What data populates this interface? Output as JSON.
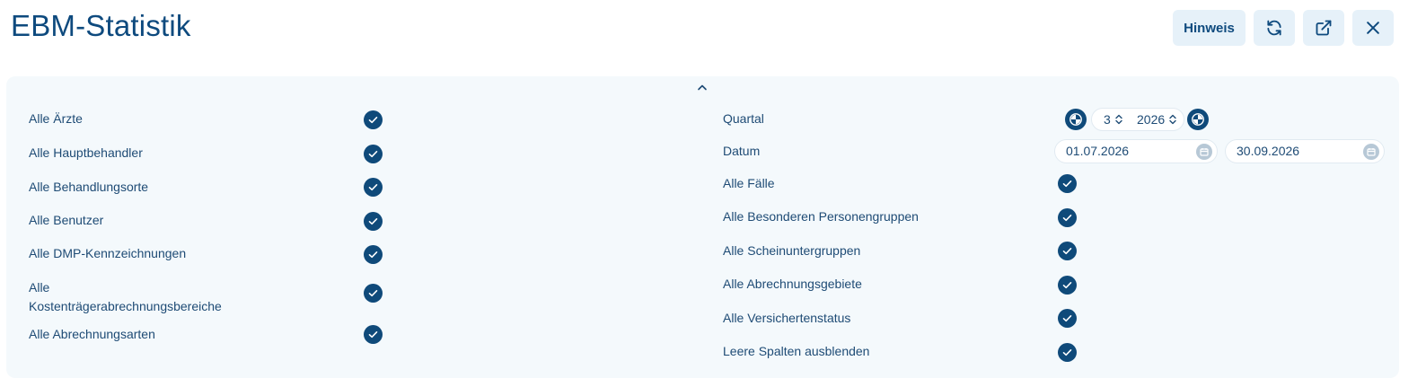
{
  "header": {
    "title": "EBM-Statistik",
    "hint_label": "Hinweis"
  },
  "icons": {
    "refresh": "refresh-icon",
    "external": "external-link-icon",
    "close": "close-icon",
    "collapse": "chevron-up-icon",
    "check": "check-icon",
    "quarter_prev": "quarter-prev-icon",
    "quarter_next": "quarter-next-icon",
    "calendar": "calendar-icon"
  },
  "colors": {
    "accent": "#0f4a7a",
    "button_bg": "#e6f1f9",
    "panel_bg": "#f4f9fc"
  },
  "left_filters": [
    {
      "label": "Alle Ärzte",
      "checked": true
    },
    {
      "label": "Alle Hauptbehandler",
      "checked": true
    },
    {
      "label": "Alle Behandlungsorte",
      "checked": true
    },
    {
      "label": "Alle Benutzer",
      "checked": true
    },
    {
      "label": "Alle DMP-Kennzeichnungen",
      "checked": true
    },
    {
      "label": "Alle",
      "label_line2": "Kostenträgerabrechnungsbereiche",
      "checked": true
    },
    {
      "label": "Alle Abrechnungsarten",
      "checked": true
    }
  ],
  "quarter": {
    "label": "Quartal",
    "quarter_value": "3",
    "year_value": "2026"
  },
  "date": {
    "label": "Datum",
    "from": "01.07.2026",
    "to": "30.09.2026"
  },
  "right_filters": [
    {
      "label": "Alle Fälle",
      "checked": true
    },
    {
      "label": "Alle Besonderen Personengruppen",
      "checked": true
    },
    {
      "label": "Alle Scheinuntergruppen",
      "checked": true
    },
    {
      "label": "Alle Abrechnungsgebiete",
      "checked": true
    },
    {
      "label": "Alle Versichertenstatus",
      "checked": true
    },
    {
      "label": "Leere Spalten ausblenden",
      "checked": true
    }
  ]
}
